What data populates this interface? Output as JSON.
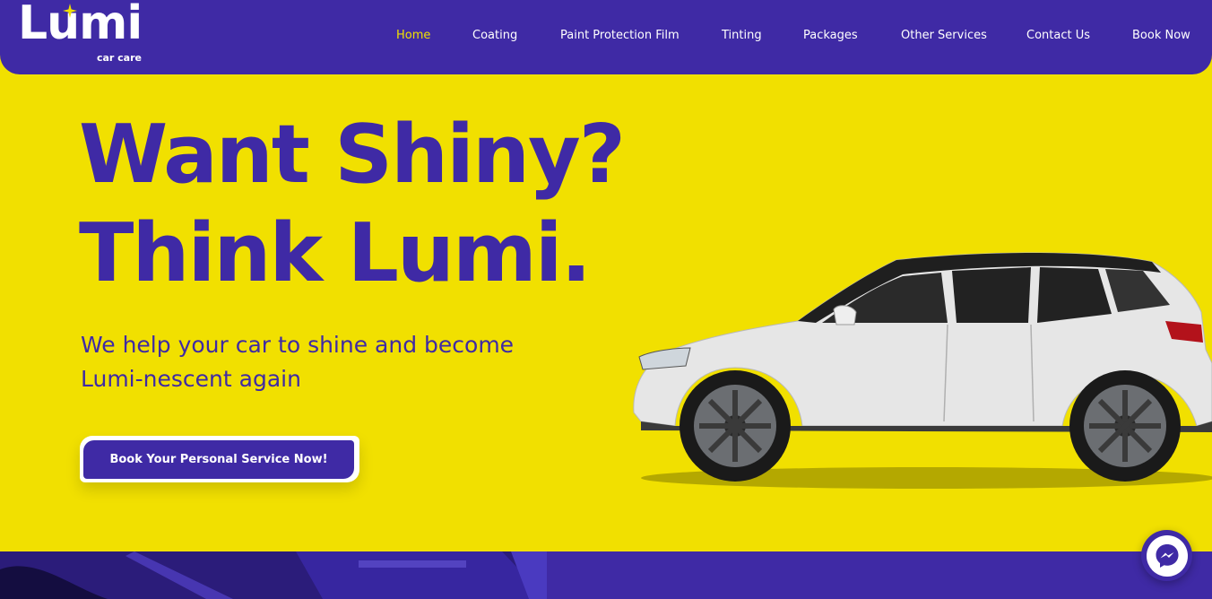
{
  "brand": {
    "name": "Lumi",
    "tagline": "car care",
    "primary_color": "#3f2aa5",
    "accent_color": "#f1e000"
  },
  "nav": {
    "items": [
      {
        "label": "Home",
        "active": true
      },
      {
        "label": "Coating",
        "active": false
      },
      {
        "label": "Paint Protection Film",
        "active": false
      },
      {
        "label": "Tinting",
        "active": false
      },
      {
        "label": "Packages",
        "active": false
      },
      {
        "label": "Other Services",
        "active": false
      },
      {
        "label": "Contact Us",
        "active": false
      },
      {
        "label": "Book Now",
        "active": false
      }
    ]
  },
  "hero": {
    "title_line1": "Want Shiny?",
    "title_line2": "Think Lumi.",
    "subtitle": "We help your car to shine and become Lumi-nescent again",
    "cta_label": "Book Your Personal Service Now!"
  },
  "icons": {
    "logo_sparkle": "sparkle-icon",
    "chat": "messenger-icon"
  }
}
